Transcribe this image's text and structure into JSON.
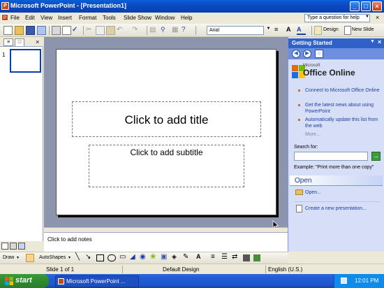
{
  "window": {
    "title": "Microsoft PowerPoint - [Presentation1]",
    "controls": [
      "minimize-icon",
      "maximize-icon",
      "close-icon"
    ]
  },
  "menubar": {
    "items": [
      "File",
      "Edit",
      "View",
      "Insert",
      "Format",
      "Tools",
      "Slide Show",
      "Window",
      "Help"
    ],
    "ask_placeholder": "Type a question for help"
  },
  "toolbar": {
    "font_name": "Arial",
    "design_label": "Design",
    "new_slide_label": "New Slide"
  },
  "slides_pane": {
    "slide_number": "1"
  },
  "slide": {
    "title_placeholder": "Click to add title",
    "subtitle_placeholder": "Click to add subtitle"
  },
  "notes": {
    "placeholder": "Click to add notes"
  },
  "task_pane": {
    "title": "Getting Started",
    "logo_small": "Microsoft",
    "logo_text": "Office Online",
    "links": [
      "Connect to Microsoft Office Online",
      "Get the latest news about using PowerPoint",
      "Automatically update this list from the web"
    ],
    "more": "More...",
    "search_label": "Search for:",
    "search_example": "Example: \"Print more than one copy\"",
    "open_heading": "Open",
    "open_link": "Open...",
    "create_link": "Create a new presentation..."
  },
  "drawing_toolbar": {
    "draw_label": "Draw",
    "autoshapes_label": "AutoShapes"
  },
  "statusbar": {
    "slide_info": "Slide 1 of 1",
    "design": "Default Design",
    "language": "English (U.S.)"
  },
  "taskbar": {
    "start_label": "start",
    "task_label": "Microsoft PowerPoint ...",
    "clock": "12:01 PM"
  },
  "colors": {
    "titlebar": "#0a4fc4",
    "taskpane_bg": "#d6dff7",
    "link": "#1c3ea1",
    "start_green": "#2e8b2e"
  }
}
